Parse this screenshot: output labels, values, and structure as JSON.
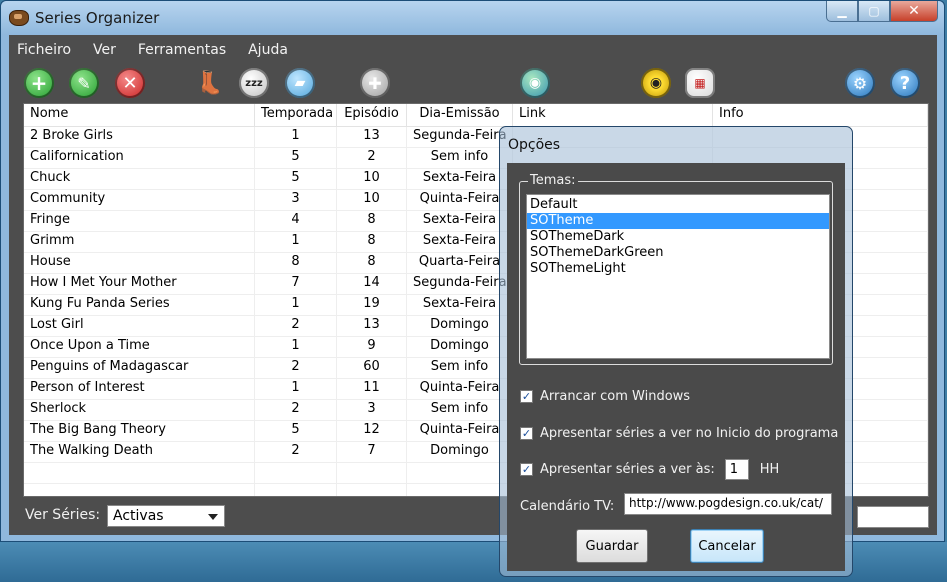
{
  "window": {
    "title": "Series Organizer"
  },
  "menu": [
    "Ficheiro",
    "Ver",
    "Ferramentas",
    "Ajuda"
  ],
  "toolbar": {
    "add_glyph": "+",
    "edit_glyph": "✎",
    "delete_glyph": "✕",
    "boot_glyph": "👢",
    "sleep_glyph": "zzz",
    "folder_glyph": "▰",
    "disabled_glyph": "✚",
    "globe_glyph": "◉",
    "eye_glyph": "◉",
    "calendar_glyph": "▦",
    "settings_glyph": "⚙",
    "help_glyph": "?"
  },
  "table": {
    "columns": [
      "Nome",
      "Temporada",
      "Episódio",
      "Dia-Emissão",
      "Link",
      "Info"
    ],
    "rows": [
      [
        "2 Broke Girls",
        "1",
        "13",
        "Segunda-Feira"
      ],
      [
        "Californication",
        "5",
        "2",
        "Sem info"
      ],
      [
        "Chuck",
        "5",
        "10",
        "Sexta-Feira"
      ],
      [
        "Community",
        "3",
        "10",
        "Quinta-Feira"
      ],
      [
        "Fringe",
        "4",
        "8",
        "Sexta-Feira"
      ],
      [
        "Grimm",
        "1",
        "8",
        "Sexta-Feira"
      ],
      [
        "House",
        "8",
        "8",
        "Quarta-Feira"
      ],
      [
        "How I Met Your Mother",
        "7",
        "14",
        "Segunda-Feira"
      ],
      [
        "Kung Fu Panda Series",
        "1",
        "19",
        "Sexta-Feira"
      ],
      [
        "Lost Girl",
        "2",
        "13",
        "Domingo"
      ],
      [
        "Once Upon a Time",
        "1",
        "9",
        "Domingo"
      ],
      [
        "Penguins of Madagascar",
        "2",
        "60",
        "Sem info"
      ],
      [
        "Person of Interest",
        "1",
        "11",
        "Quinta-Feira"
      ],
      [
        "Sherlock",
        "2",
        "3",
        "Sem info"
      ],
      [
        "The Big Bang Theory",
        "5",
        "12",
        "Quinta-Feira"
      ],
      [
        "The Walking Death",
        "2",
        "7",
        "Domingo"
      ]
    ]
  },
  "footer": {
    "label": "Ver Séries:",
    "filter_value": "Activas"
  },
  "dialog": {
    "title": "Opções",
    "themes_label": "Temas:",
    "themes": [
      "Default",
      "SOTheme",
      "SOThemeDark",
      "SOThemeDarkGreen",
      "SOThemeLight"
    ],
    "selected_theme": "SOTheme",
    "start_with_windows": "Arrancar com Windows",
    "show_on_start": "Apresentar séries a ver no Inicio do programa",
    "show_at": "Apresentar séries a ver às:",
    "hour_value": "1",
    "hour_unit": "HH",
    "calendar_label": "Calendário TV:",
    "calendar_url": "http://www.pogdesign.co.uk/cat/",
    "check_glyph": "✓",
    "save_label": "Guardar",
    "cancel_label": "Cancelar"
  }
}
